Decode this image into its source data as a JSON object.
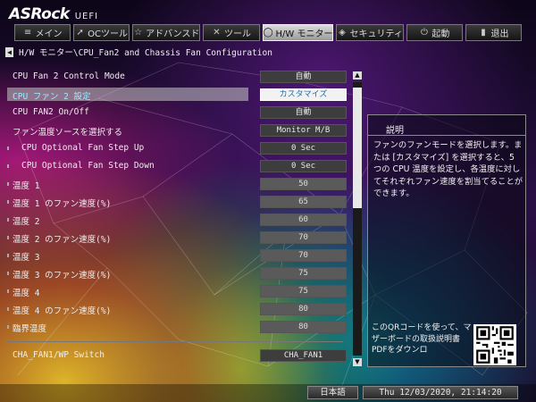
{
  "header": {
    "brand": "ASRock",
    "product": "UEFI"
  },
  "tabs": [
    {
      "label": "メイン",
      "icon": "list-icon",
      "active": false
    },
    {
      "label": "OCツール",
      "icon": "rocket-icon",
      "active": false
    },
    {
      "label": "アドバンスド",
      "icon": "star-icon",
      "active": false
    },
    {
      "label": "ツール",
      "icon": "wrench-icon",
      "active": false
    },
    {
      "label": "H/W モニター",
      "icon": "circle-icon",
      "active": true
    },
    {
      "label": "セキュリティ",
      "icon": "shield-icon",
      "active": false
    },
    {
      "label": "起動",
      "icon": "power-icon",
      "active": false
    },
    {
      "label": "退出",
      "icon": "exit-icon",
      "active": false
    }
  ],
  "breadcrumb": "H/W モニター\\CPU_Fan2 and Chassis Fan Configuration",
  "settings": [
    {
      "label": "CPU Fan 2 Control Mode",
      "value": "自動"
    },
    {
      "label": "CPU ファン 2 設定",
      "value": "カスタマイズ"
    },
    {
      "label": "CPU FAN2 On/Off",
      "value": "自動"
    },
    {
      "label": "ファン温度ソースを選択する",
      "value": "Monitor M/B"
    },
    {
      "label": "CPU Optional Fan Step Up",
      "value": "0 Sec"
    },
    {
      "label": "CPU Optional Fan Step Down",
      "value": "0 Sec"
    },
    {
      "label": "温度 1",
      "value": "50"
    },
    {
      "label": "温度 1 のファン速度(%)",
      "value": "65"
    },
    {
      "label": "温度 2",
      "value": "60"
    },
    {
      "label": "温度 2 のファン速度(%)",
      "value": "70"
    },
    {
      "label": "温度 3",
      "value": "70"
    },
    {
      "label": "温度 3 のファン速度(%)",
      "value": "75"
    },
    {
      "label": "温度 4",
      "value": "75"
    },
    {
      "label": "温度 4 のファン速度(%)",
      "value": "80"
    },
    {
      "label": "臨界温度",
      "value": "80"
    }
  ],
  "cha_fan": {
    "label": "CHA_FAN1/WP Switch",
    "value": "CHA_FAN1"
  },
  "description": {
    "title": "説明",
    "text": "ファンのファンモードを選択します。または [カスタマイズ] を選択すると、5 つの CPU 温度を設定し、各温度に対してそれぞれファン速度を割当てることができます。"
  },
  "qr_text": "このQRコードを使って、マザーボードの取扱説明書PDFをダウンロ",
  "footer": {
    "language": "日本語",
    "datetime": "Thu 12/03/2020, 21:14:20"
  }
}
